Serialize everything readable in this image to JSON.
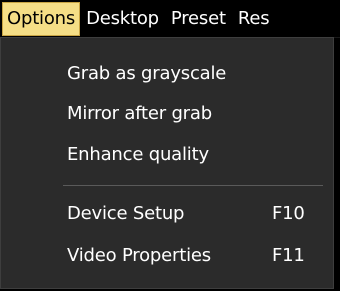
{
  "menubar": {
    "items": [
      {
        "label": "Options"
      },
      {
        "label": "Desktop"
      },
      {
        "label": "Preset"
      },
      {
        "label": "Res"
      }
    ]
  },
  "dropdown": {
    "items": [
      {
        "label": "Grab as grayscale",
        "shortcut": ""
      },
      {
        "label": "Mirror after grab",
        "shortcut": ""
      },
      {
        "label": "Enhance quality",
        "shortcut": ""
      },
      {
        "label": "Device Setup",
        "shortcut": "F10"
      },
      {
        "label": "Video Properties",
        "shortcut": "F11"
      }
    ]
  }
}
